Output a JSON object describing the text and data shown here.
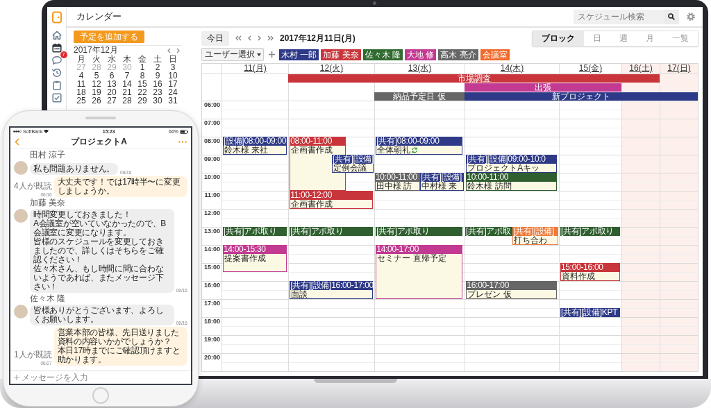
{
  "app": {
    "title": "カレンダー",
    "search": {
      "placeholder": "スケジュール検索"
    }
  },
  "rail": [
    {
      "kind": "home",
      "selected": false
    },
    {
      "kind": "calendar",
      "selected": true
    },
    {
      "kind": "chat",
      "selected": false,
      "badge": "7"
    },
    {
      "kind": "history",
      "selected": false
    },
    {
      "kind": "clipboard",
      "selected": false
    },
    {
      "kind": "check",
      "selected": false
    }
  ],
  "add_button": "予定を追加する",
  "mini_calendar": {
    "title": "2017年12月",
    "weekdays": [
      "月",
      "火",
      "水",
      "木",
      "金",
      "土",
      "日"
    ],
    "weeks": [
      [
        {
          "day": "27",
          "muted": true
        },
        {
          "day": "28",
          "muted": true
        },
        {
          "day": "29",
          "muted": true
        },
        {
          "day": "30",
          "muted": true
        },
        {
          "day": "1",
          "muted": false
        },
        {
          "day": "2",
          "muted": false
        },
        {
          "day": "3",
          "muted": false
        }
      ],
      [
        {
          "day": "4",
          "muted": false
        },
        {
          "day": "5",
          "muted": false
        },
        {
          "day": "6",
          "muted": false
        },
        {
          "day": "7",
          "muted": false
        },
        {
          "day": "8",
          "muted": false
        },
        {
          "day": "9",
          "muted": false
        },
        {
          "day": "10",
          "muted": false
        }
      ],
      [
        {
          "day": "11",
          "muted": false
        },
        {
          "day": "12",
          "muted": false
        },
        {
          "day": "13",
          "muted": false
        },
        {
          "day": "14",
          "muted": false
        },
        {
          "day": "15",
          "muted": false
        },
        {
          "day": "16",
          "muted": false
        },
        {
          "day": "17",
          "muted": false
        }
      ],
      [
        {
          "day": "18",
          "muted": false
        },
        {
          "day": "19",
          "muted": false
        },
        {
          "day": "20",
          "muted": false
        },
        {
          "day": "21",
          "muted": false
        },
        {
          "day": "22",
          "muted": false
        },
        {
          "day": "23",
          "muted": false
        },
        {
          "day": "24",
          "muted": false
        }
      ],
      [
        {
          "day": "25",
          "muted": false
        },
        {
          "day": "26",
          "muted": false
        },
        {
          "day": "27",
          "muted": false
        },
        {
          "day": "28",
          "muted": false
        },
        {
          "day": "29",
          "muted": false
        },
        {
          "day": "30",
          "muted": false
        },
        {
          "day": "31",
          "muted": false
        }
      ]
    ]
  },
  "toolbar": {
    "today": "今日",
    "date": "2017年12月11日(月)",
    "views": [
      {
        "label": "ブロック",
        "selected": true
      },
      {
        "label": "日",
        "selected": false
      },
      {
        "label": "週",
        "selected": false
      },
      {
        "label": "月",
        "selected": false
      },
      {
        "label": "一覧",
        "selected": false
      }
    ]
  },
  "filter": {
    "user_select": "ユーザー選択",
    "users": [
      {
        "name": "木村 一郎",
        "color": "#2e3a87"
      },
      {
        "name": "加藤 美奈",
        "color": "#c8353a"
      },
      {
        "name": "佐々木 隆",
        "color": "#2f6a2f"
      },
      {
        "name": "大地 修",
        "color": "#c23a92"
      },
      {
        "name": "高木 亮介",
        "color": "#666666"
      },
      {
        "name": "会議室",
        "color": "#f06a2a"
      }
    ]
  },
  "calendar": {
    "days": [
      {
        "label": "11(月)",
        "weekend": false,
        "events": [
          {
            "header": "[設備]08:00-09:00",
            "title": "鈴木様 来社",
            "color": "#2e3a87"
          },
          {
            "header": "[共有]アポ取り",
            "color": "#2f5f2f"
          },
          {
            "header": "14:00-15:30",
            "title": "提案書作成",
            "color": "#c23a92"
          }
        ]
      },
      {
        "label": "12(火)",
        "weekend": false,
        "events": [
          {
            "header": "08:00-11:00",
            "title": "企画書作成",
            "color": "#c8353a"
          },
          {
            "header": "[共有][設備]",
            "title": "定例会議",
            "color": "#2e3a87"
          },
          {
            "header": "11:00-12:00",
            "title": "企画書作成",
            "color": "#c8353a"
          },
          {
            "header": "[共有]アポ取り",
            "color": "#2f5f2f"
          },
          {
            "header": "[共有][設備]16:00-17:00",
            "title": "面談",
            "color": "#2e3a87"
          }
        ]
      },
      {
        "label": "13(水)",
        "weekend": false,
        "events": [
          {
            "header": "[共有]08:00-09:00",
            "title": "全体朝礼",
            "color": "#2e3a87"
          },
          {
            "header": "10:00-11:00",
            "title": "田中様 訪",
            "color": "#666666"
          },
          {
            "header": "[共有][設備]",
            "title": "中村様 来",
            "color": "#2e3a87"
          },
          {
            "header": "[共有]アポ取り",
            "color": "#2f5f2f"
          },
          {
            "header": "14:00-17:00",
            "title": "セミナー 直帰予定",
            "color": "#c23a92"
          }
        ]
      },
      {
        "label": "14(木)",
        "weekend": false,
        "events": [
          {
            "header": "[共有][設備]09:00-10:0",
            "title": "プロジェクトAキッ",
            "color": "#2e3a87"
          },
          {
            "header": "10:00-11:00",
            "title": "鈴木様 訪問",
            "color": "#2f5f2f"
          },
          {
            "header": "[共有]アポ取",
            "color": "#2f5f2f"
          },
          {
            "header": "[共有][設備]",
            "title": "打ち合わ",
            "color": "#f07a3a"
          },
          {
            "header": "16:00-17:00",
            "title": "プレゼン 仮",
            "color": "#666666"
          }
        ]
      },
      {
        "label": "15(金)",
        "weekend": false,
        "events": [
          {
            "header": "[共有]アポ取り",
            "color": "#2f5f2f"
          },
          {
            "header": "15:00-16:00",
            "title": "資料作成",
            "color": "#c8353a"
          },
          {
            "header": "[共有][設備]KPT",
            "color": "#2e3a87"
          }
        ]
      },
      {
        "label": "16(土)",
        "weekend": true
      },
      {
        "label": "17(日)",
        "weekend": true
      }
    ],
    "allday_rows": [
      [
        {
          "kind": "empty"
        },
        {
          "kind": "start",
          "title": "市場調査",
          "color": "#c8353a"
        },
        {
          "kind": "cont"
        },
        {
          "kind": "cont"
        },
        {
          "kind": "cont"
        },
        {
          "kind": "cont"
        },
        {
          "kind": "empty"
        }
      ],
      [
        {
          "kind": "empty"
        },
        {
          "kind": "empty"
        },
        {
          "kind": "empty"
        },
        {
          "kind": "start",
          "title": "出張",
          "color": "#c23a92"
        },
        {
          "kind": "cont"
        },
        {
          "kind": "empty"
        },
        {
          "kind": "empty"
        }
      ],
      [
        {
          "kind": "empty"
        },
        {
          "kind": "empty"
        },
        {
          "kind": "start",
          "title": "納品予定日 仮",
          "color": "#666666"
        },
        {
          "kind": "start",
          "title": "新プロジェクト",
          "color": "#2e3a87"
        },
        {
          "kind": "cont"
        },
        {
          "kind": "cont"
        },
        {
          "kind": "cont"
        }
      ]
    ],
    "hours": [
      "06:00",
      "07:00",
      "08:00",
      "09:00",
      "10:00",
      "11:00",
      "12:00",
      "13:00",
      "14:00",
      "15:00",
      "16:00",
      "17:00",
      "18:00",
      "19:00",
      "20:00"
    ]
  },
  "phone": {
    "status": {
      "carrier": "SoftBank",
      "time": "15:23",
      "battery": "66%"
    },
    "title": "プロジェクトA",
    "messages": [
      {
        "kind": "incoming",
        "sender": "田村 涼子",
        "lines": [
          "私も問題ありません。"
        ],
        "time": "06/16"
      },
      {
        "kind": "outgoing",
        "read": "4人が既読",
        "time": "06/16",
        "lines": [
          "大丈夫です！では17時半〜に変更しましょうか。"
        ]
      },
      {
        "kind": "incoming",
        "sender": "加藤 美奈",
        "lines": [
          "時間変更しておきました！",
          "A会議室が空いていなかったので、B会議室に変更になります。",
          "皆様のスケジュールを変更しておきましたので、詳しくはそちらをご確認ください！",
          "佐々木さん、もし時間に間に合わないようであれば、またメッセージ下さい！"
        ],
        "time": "06/16"
      },
      {
        "kind": "incoming",
        "sender": "佐々木 隆",
        "lines": [
          "皆様ありがとうございます、よろしくお願いします。"
        ],
        "time": "06/16"
      },
      {
        "kind": "outgoing",
        "read": "1人が既読",
        "time": "06/27",
        "lines": [
          "営業本部の皆様、先日送りました資料の内容いかがでしょうか？",
          "本日17時までにご確認頂けますと助かります。"
        ]
      }
    ],
    "input": {
      "placeholder": "メッセージを入力"
    }
  }
}
